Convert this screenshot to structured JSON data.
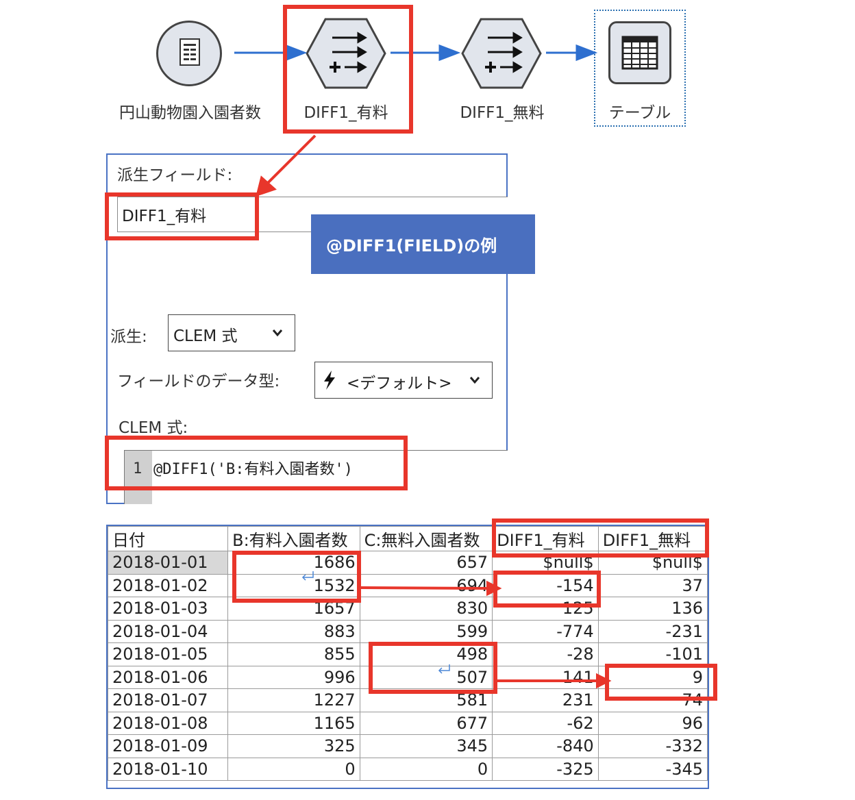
{
  "flow": {
    "nodes": [
      {
        "label": "円山動物園入園者数",
        "icon": "data-source-icon"
      },
      {
        "label": "DIFF1_有料",
        "icon": "derive-node-icon"
      },
      {
        "label": "DIFF1_無料",
        "icon": "derive-node-icon"
      },
      {
        "label": "テーブル",
        "icon": "table-output-icon"
      }
    ]
  },
  "dialog": {
    "derive_field_label": "派生フィールド:",
    "derive_field_value": "DIFF1_有料",
    "derive_label": "派生:",
    "derive_select": "CLEM 式",
    "datatype_label": "フィールドのデータ型:",
    "datatype_select": "<デフォルト>",
    "clem_label": "CLEM 式:",
    "line_number": "1",
    "expression": "@DIFF1('B:有料入園者数')"
  },
  "callout": "@DIFF1(FIELD)の例",
  "table": {
    "columns": [
      "日付",
      "B:有料入園者数",
      "C:無料入園者数",
      "DIFF1_有料",
      "DIFF1_無料"
    ],
    "rows": [
      [
        "2018-01-01",
        "1686",
        "657",
        "$null$",
        "$null$"
      ],
      [
        "2018-01-02",
        "1532",
        "694",
        "-154",
        "37"
      ],
      [
        "2018-01-03",
        "1657",
        "830",
        "125",
        "136"
      ],
      [
        "2018-01-04",
        "883",
        "599",
        "-774",
        "-231"
      ],
      [
        "2018-01-05",
        "855",
        "498",
        "-28",
        "-101"
      ],
      [
        "2018-01-06",
        "996",
        "507",
        "141",
        "9"
      ],
      [
        "2018-01-07",
        "1227",
        "581",
        "231",
        "74"
      ],
      [
        "2018-01-08",
        "1165",
        "677",
        "-62",
        "96"
      ],
      [
        "2018-01-09",
        "325",
        "345",
        "-840",
        "-332"
      ],
      [
        "2018-01-10",
        "0",
        "0",
        "-325",
        "-345"
      ]
    ]
  },
  "colors": {
    "highlight": "#e8362b",
    "flow_arrow": "#2e6fcf",
    "callout": "#4a6fbf"
  }
}
